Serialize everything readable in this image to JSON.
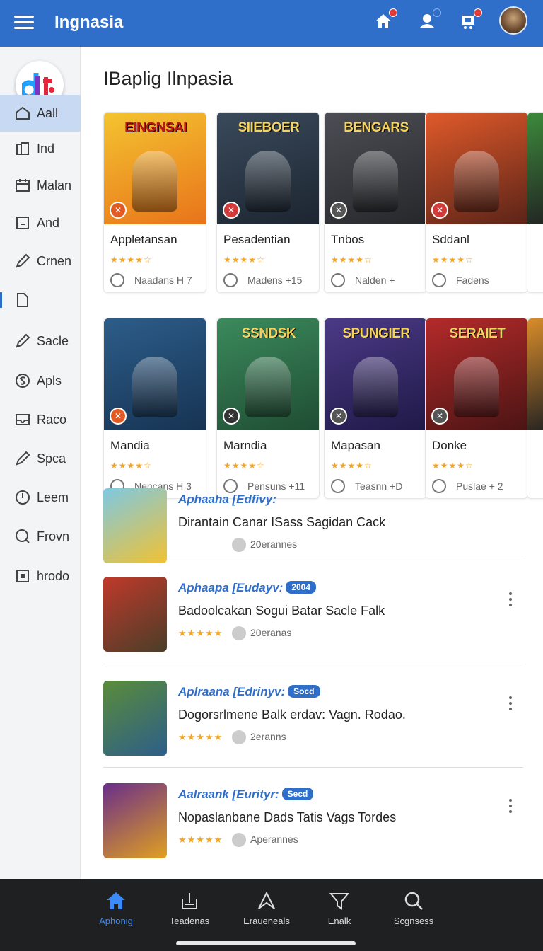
{
  "app": {
    "title": "Ingnasia",
    "accent": "#2f6ec9"
  },
  "topbar": {
    "icons": [
      "home-icon",
      "profile-icon",
      "cart-icon"
    ]
  },
  "sidebar": {
    "items": [
      {
        "label": "Aall",
        "icon": "home-outline-icon",
        "active": true
      },
      {
        "label": "Ind",
        "icon": "book-icon"
      },
      {
        "label": "Malan",
        "icon": "calendar-icon"
      },
      {
        "label": "And",
        "icon": "box-icon"
      },
      {
        "label": "Crnen",
        "icon": "pen-icon"
      },
      {
        "label": "",
        "icon": "file-icon"
      },
      {
        "label": "Sacle",
        "icon": "pen-icon"
      },
      {
        "label": "Apls",
        "icon": "dollar-icon"
      },
      {
        "label": "Raco",
        "icon": "inbox-icon"
      },
      {
        "label": "Spca",
        "icon": "pen-icon"
      },
      {
        "label": "Leem",
        "icon": "power-icon"
      },
      {
        "label": "Frovn",
        "icon": "search-circle-icon"
      },
      {
        "label": "hrodo",
        "icon": "grid-icon"
      }
    ]
  },
  "main": {
    "heading": "IBaplig Ilnpasia",
    "row1": [
      {
        "name": "Appletansan",
        "thumb_title": "EINGNSAI",
        "rating": 4,
        "meta": "Naadans H 7",
        "bg": [
          "#f4c430",
          "#e8731a"
        ],
        "badge": "#e25a24"
      },
      {
        "name": "Pesadentian",
        "thumb_title": "SIIEBOER",
        "rating": 4,
        "meta": "Madens +15",
        "bg": [
          "#3a4a5c",
          "#1c2530"
        ],
        "badge": "#d33b3b"
      },
      {
        "name": "Tnbos",
        "thumb_title": "BENGARS",
        "rating": 4,
        "meta": "Nalden + ",
        "bg": [
          "#4d4e55",
          "#26272b"
        ],
        "badge": "#555"
      },
      {
        "name": "Sddanl",
        "thumb_title": "",
        "rating": 4,
        "meta": "Fadens",
        "bg": [
          "#e05a2a",
          "#5a2318"
        ],
        "badge": "#d33b3b"
      }
    ],
    "row2": [
      {
        "name": "Mandia",
        "thumb_title": "",
        "rating": 4,
        "meta": "Nencans H 3",
        "bg": [
          "#2c5d8a",
          "#173352"
        ],
        "badge": "#e25a24"
      },
      {
        "name": "Marndia",
        "thumb_title": "SSNDSK",
        "rating": 4,
        "meta": "Pensuns +11",
        "bg": [
          "#3b8a5c",
          "#1f4d33"
        ],
        "badge": "#333"
      },
      {
        "name": "Mapasan",
        "thumb_title": "SPUNGIER",
        "rating": 4,
        "meta": "Teasnn +D",
        "bg": [
          "#4b3a86",
          "#1f1947"
        ],
        "badge": "#555"
      },
      {
        "name": "Donke",
        "thumb_title": "SERAIET",
        "rating": 4,
        "meta": "Puslae + 2",
        "bg": [
          "#b42a2a",
          "#4b1414"
        ],
        "badge": "#555"
      }
    ],
    "list": [
      {
        "head": "Aphaaha [Edfivy:",
        "pill": "",
        "desc": "Dirantain Canar ISass Sagidan Cack",
        "rating": 0,
        "count": "20erannes",
        "sub": "",
        "thumb_bg": [
          "#7ec8e3",
          "#f1c232"
        ]
      },
      {
        "head": "Aphaapa [Eudayv:",
        "pill": "2004",
        "desc": "Badoolcakan Sogui Batar Sacle Falk",
        "rating": 5,
        "count": "20eranas",
        "thumb_bg": [
          "#c0392b",
          "#4a3e28"
        ]
      },
      {
        "head": "Aplraana [Edrinyv:",
        "pill": "Socd",
        "desc": "Dogorsrlmene Balk erdav: Vagn. Rodao.",
        "rating": 5,
        "count": "2eranns",
        "thumb_bg": [
          "#5a8c3a",
          "#2d5e8a"
        ]
      },
      {
        "head": "Aalraank [Eurityr:",
        "pill": "Secd",
        "desc": "Nopaslanbane Dads Tatis Vags Tordes",
        "rating": 5,
        "count": "Aperannes",
        "thumb_bg": [
          "#6a2d8a",
          "#e0a020"
        ]
      }
    ]
  },
  "bottomnav": {
    "items": [
      {
        "label": "Aphonig",
        "icon": "home-icon",
        "active": true
      },
      {
        "label": "Teadenas",
        "icon": "grid-plus-icon"
      },
      {
        "label": "Eraueneals",
        "icon": "arrow-send-icon"
      },
      {
        "label": "Enalk",
        "icon": "filter-icon"
      },
      {
        "label": "Scgnsess",
        "icon": "search-icon"
      }
    ]
  }
}
